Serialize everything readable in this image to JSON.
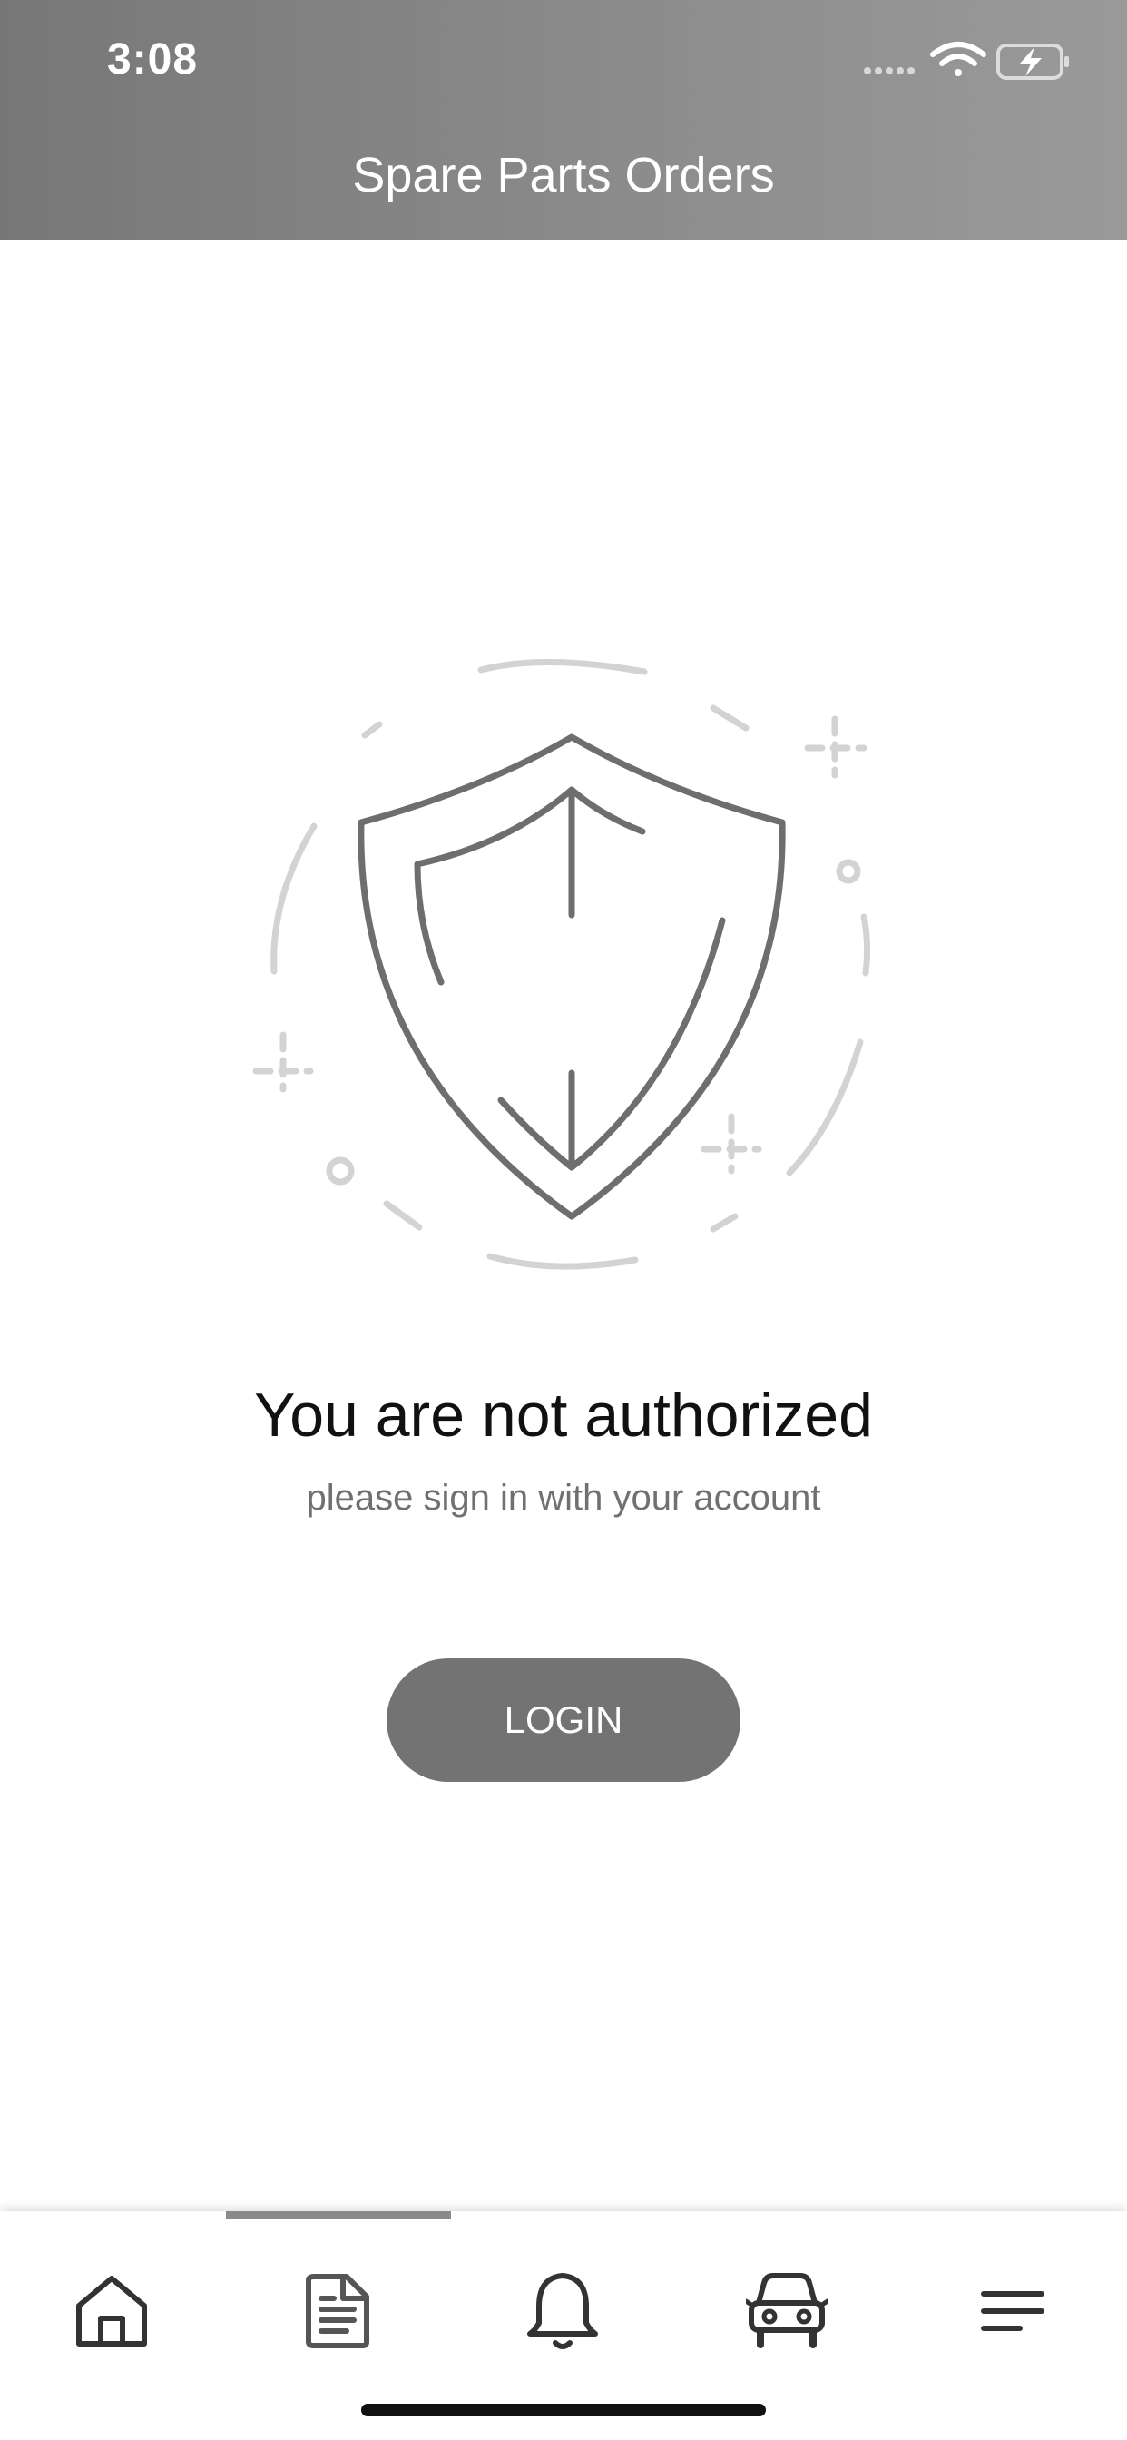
{
  "status_bar": {
    "time": "3:08",
    "icons": [
      "signal-dots-icon",
      "wifi-icon",
      "battery-charging-icon"
    ]
  },
  "header": {
    "title": "Spare Parts Orders"
  },
  "main": {
    "illustration": "shield-icon",
    "heading": "You are not authorized",
    "subheading": "please sign in with your account",
    "login_label": "LOGIN"
  },
  "tabbar": {
    "active_index": 1,
    "tabs": [
      {
        "icon": "home-icon"
      },
      {
        "icon": "document-icon"
      },
      {
        "icon": "bell-icon"
      },
      {
        "icon": "car-icon"
      },
      {
        "icon": "menu-icon"
      }
    ]
  },
  "colors": {
    "header_bg": "#8a8a8a",
    "button_bg": "#737373",
    "icon_dark": "#333333",
    "illustration_stroke": "#6e6e6e",
    "illustration_accent": "#d3d3d3"
  }
}
